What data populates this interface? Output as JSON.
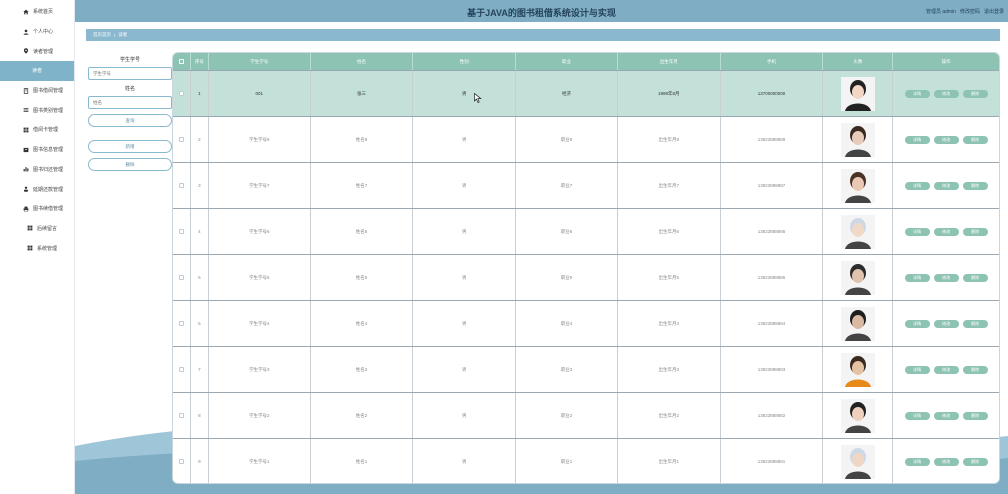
{
  "header": {
    "title": "基于JAVA的图书租借系统设计与实现",
    "user": "管理员 admin",
    "change_password": "修改密码",
    "logout": "退出登录"
  },
  "sidebar": {
    "items": [
      {
        "label": "系统首页",
        "icon": "home-icon"
      },
      {
        "label": "个人中心",
        "icon": "user-icon"
      },
      {
        "label": "读者管理",
        "icon": "pin-icon"
      },
      {
        "label": "读者",
        "icon": ""
      },
      {
        "label": "图书借阅管理",
        "icon": "book-icon"
      },
      {
        "label": "图书类别管理",
        "icon": "list-icon"
      },
      {
        "label": "借阅卡管理",
        "icon": "grid-icon"
      },
      {
        "label": "图书信息管理",
        "icon": "archive-icon"
      },
      {
        "label": "图书归还管理",
        "icon": "chart-icon"
      },
      {
        "label": "延期还款管理",
        "icon": "person-icon"
      },
      {
        "label": "图书续借管理",
        "icon": "printer-icon"
      },
      {
        "label": "后续留言",
        "icon": "grid-icon"
      },
      {
        "label": "系统管理",
        "icon": "grid-icon"
      }
    ]
  },
  "breadcrumb": {
    "home": "首页首页",
    "separator": "/",
    "current": "读者"
  },
  "search": {
    "student_label": "学生学号",
    "student_placeholder": "学生学号",
    "name_label": "姓名",
    "name_placeholder": "姓名",
    "search_button": "查询",
    "add_button": "新增",
    "delete_button": "删除"
  },
  "table": {
    "columns": [
      "序号",
      "学生学号",
      "姓名",
      "性别",
      "职业",
      "出生年月",
      "手机",
      "头像",
      "操作"
    ],
    "actions": {
      "detail": "详情",
      "edit": "修改",
      "delete": "删除"
    },
    "rows": [
      {
        "idx": "1",
        "student_id": "001",
        "name": "张三",
        "sex": "男",
        "job": "经济",
        "birth": "1998年8月",
        "phone": "13700000000"
      },
      {
        "idx": "2",
        "student_id": "学生学号9",
        "name": "姓名9",
        "sex": "男",
        "job": "职业9",
        "birth": "出生年月9",
        "phone": "13823888889"
      },
      {
        "idx": "3",
        "student_id": "学生学号7",
        "name": "姓名7",
        "sex": "男",
        "job": "职业7",
        "birth": "出生年月7",
        "phone": "13823888887"
      },
      {
        "idx": "4",
        "student_id": "学生学号6",
        "name": "姓名6",
        "sex": "男",
        "job": "职业6",
        "birth": "出生年月6",
        "phone": "13823888886"
      },
      {
        "idx": "5",
        "student_id": "学生学号5",
        "name": "姓名5",
        "sex": "男",
        "job": "职业5",
        "birth": "出生年月5",
        "phone": "13823888885"
      },
      {
        "idx": "6",
        "student_id": "学生学号4",
        "name": "姓名4",
        "sex": "男",
        "job": "职业4",
        "birth": "出生年月4",
        "phone": "13823888884"
      },
      {
        "idx": "7",
        "student_id": "学生学号3",
        "name": "姓名3",
        "sex": "男",
        "job": "职业3",
        "birth": "出生年月3",
        "phone": "13823888883"
      },
      {
        "idx": "8",
        "student_id": "学生学号2",
        "name": "姓名2",
        "sex": "男",
        "job": "职业2",
        "birth": "出生年月2",
        "phone": "13823888882"
      },
      {
        "idx": "9",
        "student_id": "学生学号1",
        "name": "姓名1",
        "sex": "男",
        "job": "职业1",
        "birth": "出生年月1",
        "phone": "13823888881"
      }
    ]
  },
  "colors": {
    "header": "#7faec4",
    "table_header": "#8cc3b2",
    "active_row": "#c3e1d8",
    "accent": "#8ab9cf"
  }
}
